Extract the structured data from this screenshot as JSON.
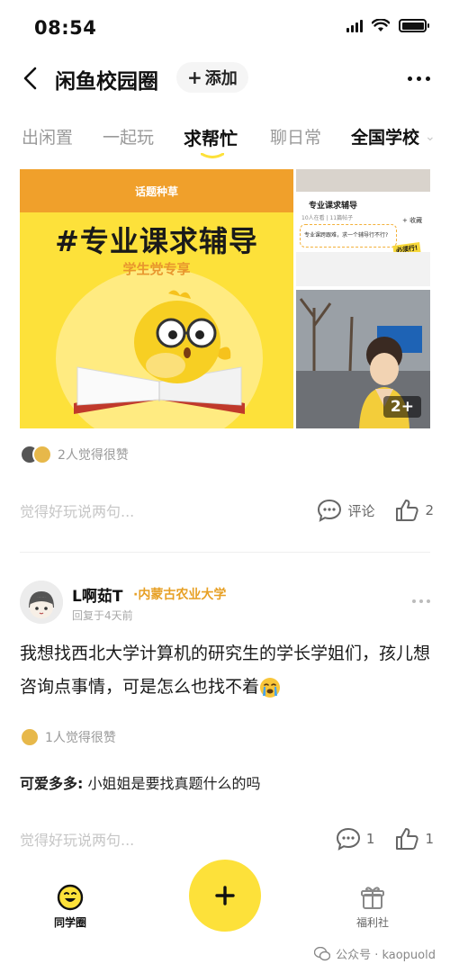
{
  "status": {
    "time": "08:54"
  },
  "nav": {
    "title": "闲鱼校园圈",
    "add_label": "添加"
  },
  "tabs": [
    {
      "label": "出闲置"
    },
    {
      "label": "一起玩"
    },
    {
      "label": "求帮忙"
    },
    {
      "label": "聊日常"
    },
    {
      "label": "全国学校"
    }
  ],
  "accent": "#fde13a",
  "feed": {
    "post1": {
      "banner_tag": "话题种草",
      "banner_headline": "#专业课求辅导",
      "banner_sub": "学生党专享",
      "side_card_title": "专业课求辅导",
      "side_card_meta": "10人在看 | 11篇帖子",
      "side_card_bubble": "专业课跨跟难，求一个辅导行不行?",
      "side_card_badge": "必须行!",
      "side_card_collect": "+ 收藏",
      "image_count": "2+",
      "likes_text": "2人觉得很赞",
      "comment_placeholder": "觉得好玩说两句...",
      "comment_label": "评论",
      "like_count": "2"
    },
    "post2": {
      "author": "L啊茹T",
      "school": "·内蒙古农业大学",
      "time": "回复于4天前",
      "body": "我想找西北大学计算机的研究生的学长学姐们，孩儿想咨询点事情，可是怎么也找不着",
      "likes_text": "1人觉得很赞",
      "reply_name": "可爱多多:",
      "reply_text": " 小姐姐是要找真题什么的吗",
      "comment_placeholder": "觉得好玩说两句...",
      "comment_count": "1",
      "like_count": "1"
    }
  },
  "tabbar": {
    "left_label": "同学圈",
    "right_label": "福利社"
  },
  "watermark": "公众号 · kaopuold"
}
